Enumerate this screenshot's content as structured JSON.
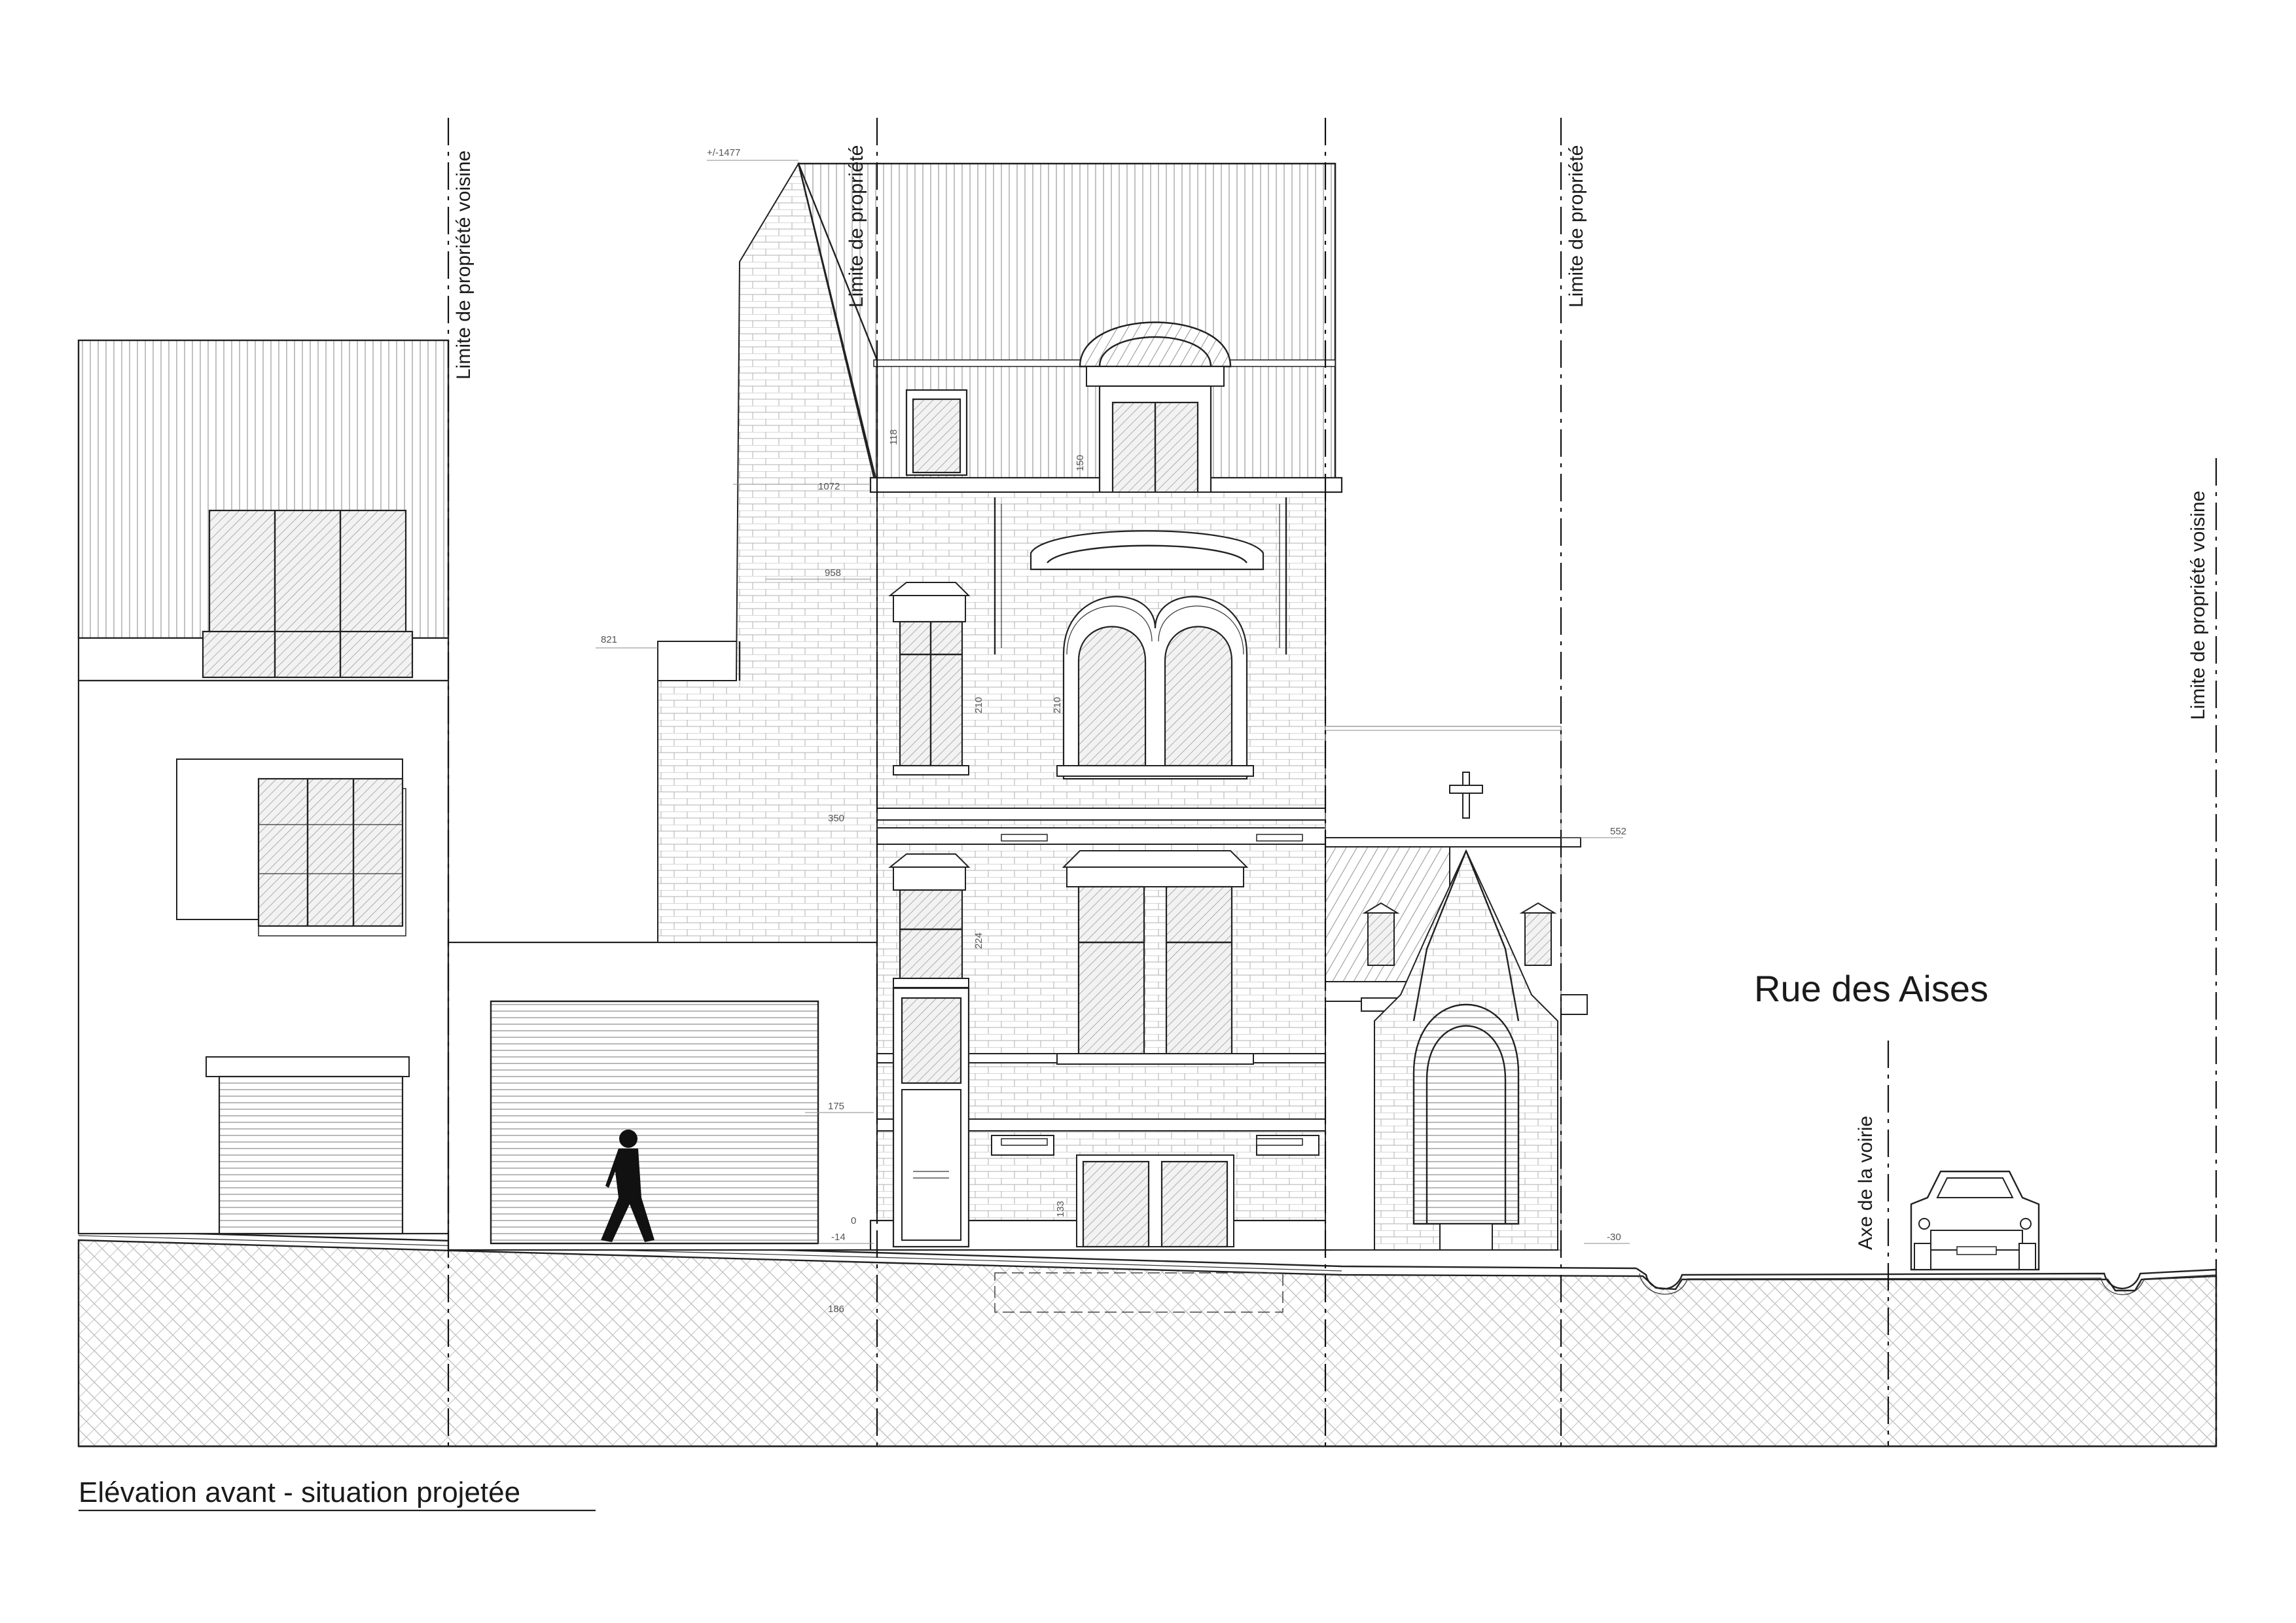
{
  "labels": {
    "property_limit": "Limite de propriété voisine",
    "property_limit_short": "Limite de propriété",
    "road_axis": "Axe de la voirie",
    "street_name": "Rue des Aises",
    "caption": "Elévation avant - situation projetée"
  },
  "dimensions": {
    "ridge": "+/-1477",
    "d1072": "1072",
    "d958": "958",
    "d821": "821",
    "d552": "552",
    "d175": "175",
    "d0": "0",
    "dm14": "-14",
    "dm30": "-30",
    "d118": "118",
    "d150": "150",
    "d350": "350",
    "d210a": "210",
    "d210b": "210",
    "d224": "224",
    "d133": "133",
    "d186": "186"
  },
  "colors": {
    "line": "#222222",
    "background": "#ffffff",
    "hatch": "#777777"
  }
}
